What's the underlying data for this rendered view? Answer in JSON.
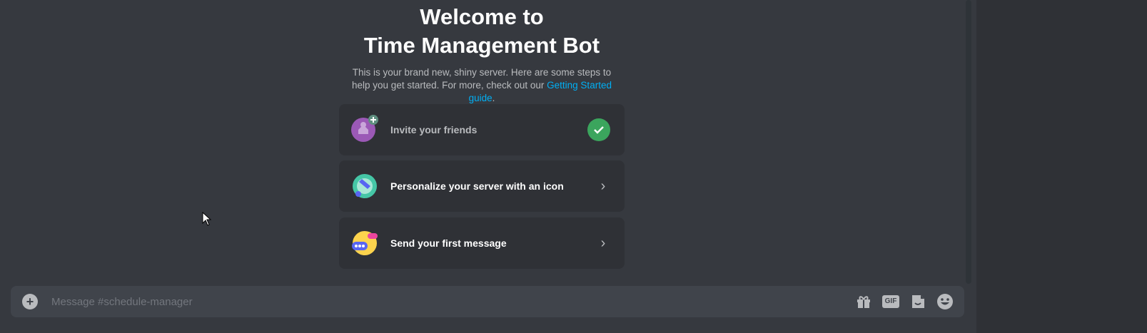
{
  "welcome": {
    "title_line1": "Welcome to",
    "title_line2": "Time Management Bot",
    "subtitle_text": "This is your brand new, shiny server. Here are some steps to help you get started. For more, check out our ",
    "subtitle_link": "Getting Started guide",
    "subtitle_end": "."
  },
  "cards": [
    {
      "label": "Invite your friends",
      "icon": "invite-friends-icon",
      "status": "completed"
    },
    {
      "label": "Personalize your server with an icon",
      "icon": "paintbrush-icon",
      "status": "pending"
    },
    {
      "label": "Send your first message",
      "icon": "chat-bubble-icon",
      "status": "pending"
    }
  ],
  "composer": {
    "placeholder": "Message #schedule-manager",
    "gif_label": "GIF"
  },
  "colors": {
    "background": "#36393f",
    "card": "#2f3136",
    "accent_link": "#00aff4",
    "success": "#3ba55d"
  }
}
